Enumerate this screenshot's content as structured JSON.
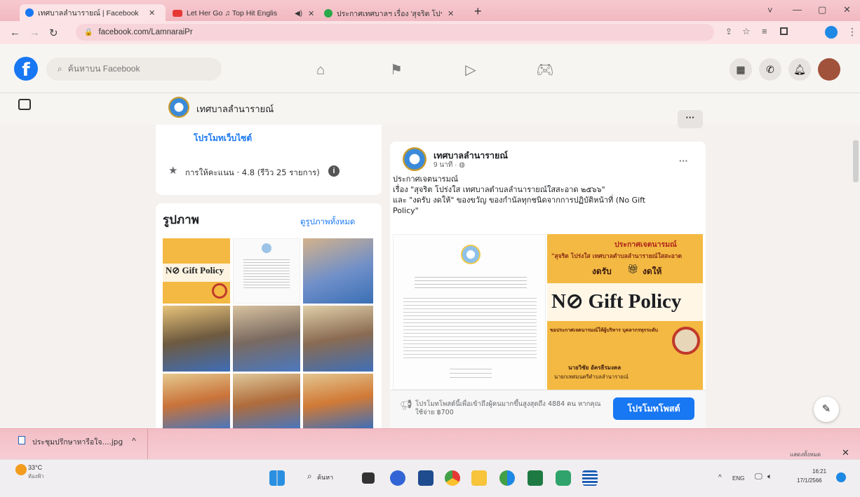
{
  "browser": {
    "tabs": [
      {
        "title": "เทศบาลลำนารายณ์ | Facebook",
        "active": true
      },
      {
        "title": "Let Her Go ♫ Top Hit Englis",
        "active": false
      },
      {
        "title": "ประกาศเทศบาลฯ เรื่อง 'สุจริต โปร่ง",
        "active": false
      }
    ],
    "new_tab": "+",
    "close_glyph": "✕",
    "url": "facebook.com/LamnaraiPr",
    "window_controls": [
      "˅",
      "—",
      "▢",
      "✕"
    ]
  },
  "fb": {
    "logo": "f",
    "search_placeholder": "ค้นหาบน Facebook",
    "page_name": "เทศบาลลำนารายณ์",
    "more": "···",
    "promote_website": "โปรโมทเว็บไซต์",
    "rating": "การให้คะแนน · 4.8 (รีวิว 25 รายการ)",
    "photos_title": "รูปภาพ",
    "photos_see_all": "ดูรูปภาพทั้งหมด",
    "post": {
      "author": "เทศบาลลำนารายณ์",
      "time": "9 นาที · ",
      "more": "···",
      "text_line1": "ประกาศเจตนารมณ์",
      "text_line2": "เรื่อง \"สุจริต โปร่งใส เทศบาลตำบลลำนารายณ์ใสสะอาด ๒๕๖๖\"",
      "text_line3": "และ \"งดรับ งดให้\" ของขวัญ ของกำนัลทุกชนิดจากการปฏิบัติหน้าที่ (No Gift",
      "text_line4": "Policy\"",
      "poster_title": "ประกาศเจตนารมณ์",
      "poster_sub": "\"สุจริต โปร่งใส เทศบาลตำบลลำนารายณ์ใสสะอาด",
      "poster_ngrub": "งดรับ",
      "poster_ngdai": "งดให้",
      "poster_nogift": "N⊘ Gift Policy",
      "poster_body": "ขอประกาศเจตนารมณ์ให้ผู้บริหาร บุคลากรทุกระดับ",
      "poster_sign1": "นายวิชัย อัครธีรมงคล",
      "poster_sign2": "นายกเทศมนตรีตำบลลำนารายณ์",
      "promote_text": "โปรโมทโพสต์นี้เพื่อเข้าถึงผู้คนมากขึ้นสูงสุดถึง 4884 คน หากคุณใช้จ่าย ฿700",
      "promote_button": "โปรโมทโพสต์"
    },
    "small_poster_title": "N⊘ Gift Policy"
  },
  "download": {
    "file": "ประชุมปรึกษาหารือใจ....jpg",
    "chevron": "^",
    "show_all": "แสดงทั้งหมด",
    "close": "✕"
  },
  "taskbar": {
    "weather_temp": "33°C",
    "weather_desc": "ท้องฟ้า",
    "search": "ค้นหา",
    "lang": "ENG",
    "time": "16:21",
    "date": "17/1/2566"
  },
  "colors": {
    "fb_blue": "#1877f2",
    "tab_pink": "#f2b8c0",
    "poster_yellow": "#f4b942",
    "poster_red": "#c0392b"
  }
}
